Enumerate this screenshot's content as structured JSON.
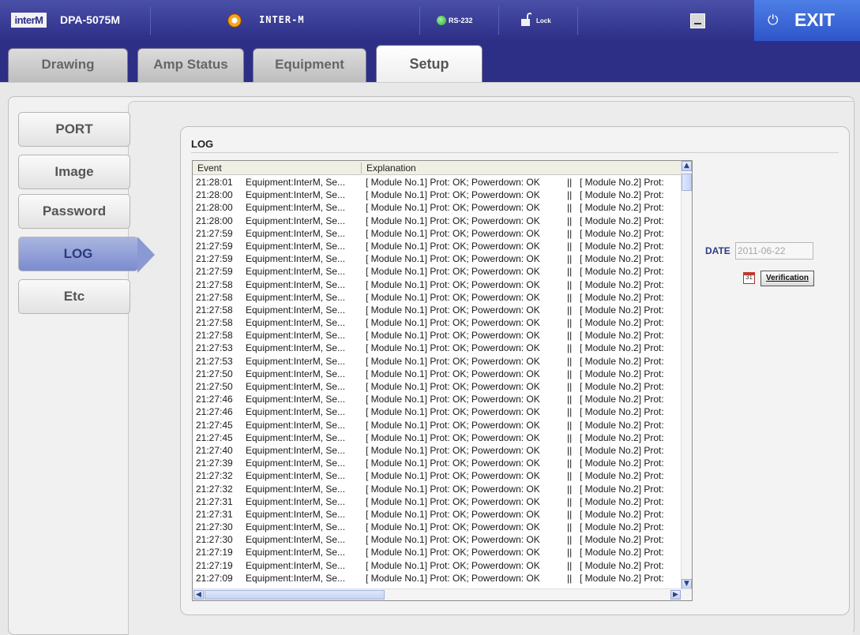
{
  "header": {
    "logo": "interM",
    "model": "DPA-5075M",
    "device_name": "INTER-M",
    "rs_label": "RS-232",
    "lock_label": "Lock",
    "exit_label": "EXIT"
  },
  "tabs": [
    {
      "label": "Drawing",
      "active": false
    },
    {
      "label": "Amp Status",
      "active": false
    },
    {
      "label": "Equipment",
      "active": false
    },
    {
      "label": "Setup",
      "active": true
    }
  ],
  "sidebar": {
    "items": [
      {
        "label": "PORT"
      },
      {
        "label": "Image"
      },
      {
        "label": "Password"
      },
      {
        "label": "LOG",
        "active": true
      },
      {
        "label": "Etc"
      }
    ]
  },
  "log": {
    "title": "LOG",
    "columns": [
      "Event",
      "Explanation"
    ],
    "rows": [
      {
        "time": "21:28:01",
        "equipment": "Equipment:InterM, Se...",
        "explanation": "[ Module No.1] Prot: OK; Powerdown: OK",
        "sep": "||",
        "module2": "[ Module No.2] Prot:"
      },
      {
        "time": "21:28:00",
        "equipment": "Equipment:InterM, Se...",
        "explanation": "[ Module No.1] Prot: OK; Powerdown: OK",
        "sep": "||",
        "module2": "[ Module No.2] Prot:"
      },
      {
        "time": "21:28:00",
        "equipment": "Equipment:InterM, Se...",
        "explanation": "[ Module No.1] Prot: OK; Powerdown: OK",
        "sep": "||",
        "module2": "[ Module No.2] Prot:"
      },
      {
        "time": "21:28:00",
        "equipment": "Equipment:InterM, Se...",
        "explanation": "[ Module No.1] Prot: OK; Powerdown: OK",
        "sep": "||",
        "module2": "[ Module No.2] Prot:"
      },
      {
        "time": "21:27:59",
        "equipment": "Equipment:InterM, Se...",
        "explanation": "[ Module No.1] Prot: OK; Powerdown: OK",
        "sep": "||",
        "module2": "[ Module No.2] Prot:"
      },
      {
        "time": "21:27:59",
        "equipment": "Equipment:InterM, Se...",
        "explanation": "[ Module No.1] Prot: OK; Powerdown: OK",
        "sep": "||",
        "module2": "[ Module No.2] Prot:"
      },
      {
        "time": "21:27:59",
        "equipment": "Equipment:InterM, Se...",
        "explanation": "[ Module No.1] Prot: OK; Powerdown: OK",
        "sep": "||",
        "module2": "[ Module No.2] Prot:"
      },
      {
        "time": "21:27:59",
        "equipment": "Equipment:InterM, Se...",
        "explanation": "[ Module No.1] Prot: OK; Powerdown: OK",
        "sep": "||",
        "module2": "[ Module No.2] Prot:"
      },
      {
        "time": "21:27:58",
        "equipment": "Equipment:InterM, Se...",
        "explanation": "[ Module No.1] Prot: OK; Powerdown: OK",
        "sep": "||",
        "module2": "[ Module No.2] Prot:"
      },
      {
        "time": "21:27:58",
        "equipment": "Equipment:InterM, Se...",
        "explanation": "[ Module No.1] Prot: OK; Powerdown: OK",
        "sep": "||",
        "module2": "[ Module No.2] Prot:"
      },
      {
        "time": "21:27:58",
        "equipment": "Equipment:InterM, Se...",
        "explanation": "[ Module No.1] Prot: OK; Powerdown: OK",
        "sep": "||",
        "module2": "[ Module No.2] Prot:"
      },
      {
        "time": "21:27:58",
        "equipment": "Equipment:InterM, Se...",
        "explanation": "[ Module No.1] Prot: OK; Powerdown: OK",
        "sep": "||",
        "module2": "[ Module No.2] Prot:"
      },
      {
        "time": "21:27:58",
        "equipment": "Equipment:InterM, Se...",
        "explanation": "[ Module No.1] Prot: OK; Powerdown: OK",
        "sep": "||",
        "module2": "[ Module No.2] Prot:"
      },
      {
        "time": "21:27:53",
        "equipment": "Equipment:InterM, Se...",
        "explanation": "[ Module No.1] Prot: OK; Powerdown: OK",
        "sep": "||",
        "module2": "[ Module No.2] Prot:"
      },
      {
        "time": "21:27:53",
        "equipment": "Equipment:InterM, Se...",
        "explanation": "[ Module No.1] Prot: OK; Powerdown: OK",
        "sep": "||",
        "module2": "[ Module No.2] Prot:"
      },
      {
        "time": "21:27:50",
        "equipment": "Equipment:InterM, Se...",
        "explanation": "[ Module No.1] Prot: OK; Powerdown: OK",
        "sep": "||",
        "module2": "[ Module No.2] Prot:"
      },
      {
        "time": "21:27:50",
        "equipment": "Equipment:InterM, Se...",
        "explanation": "[ Module No.1] Prot: OK; Powerdown: OK",
        "sep": "||",
        "module2": "[ Module No.2] Prot:"
      },
      {
        "time": "21:27:46",
        "equipment": "Equipment:InterM, Se...",
        "explanation": "[ Module No.1] Prot: OK; Powerdown: OK",
        "sep": "||",
        "module2": "[ Module No.2] Prot:"
      },
      {
        "time": "21:27:46",
        "equipment": "Equipment:InterM, Se...",
        "explanation": "[ Module No.1] Prot: OK; Powerdown: OK",
        "sep": "||",
        "module2": "[ Module No.2] Prot:"
      },
      {
        "time": "21:27:45",
        "equipment": "Equipment:InterM, Se...",
        "explanation": "[ Module No.1] Prot: OK; Powerdown: OK",
        "sep": "||",
        "module2": "[ Module No.2] Prot:"
      },
      {
        "time": "21:27:45",
        "equipment": "Equipment:InterM, Se...",
        "explanation": "[ Module No.1] Prot: OK; Powerdown: OK",
        "sep": "||",
        "module2": "[ Module No.2] Prot:"
      },
      {
        "time": "21:27:40",
        "equipment": "Equipment:InterM, Se...",
        "explanation": "[ Module No.1] Prot: OK; Powerdown: OK",
        "sep": "||",
        "module2": "[ Module No.2] Prot:"
      },
      {
        "time": "21:27:39",
        "equipment": "Equipment:InterM, Se...",
        "explanation": "[ Module No.1] Prot: OK; Powerdown: OK",
        "sep": "||",
        "module2": "[ Module No.2] Prot:"
      },
      {
        "time": "21:27:32",
        "equipment": "Equipment:InterM, Se...",
        "explanation": "[ Module No.1] Prot: OK; Powerdown: OK",
        "sep": "||",
        "module2": "[ Module No.2] Prot:"
      },
      {
        "time": "21:27:32",
        "equipment": "Equipment:InterM, Se...",
        "explanation": "[ Module No.1] Prot: OK; Powerdown: OK",
        "sep": "||",
        "module2": "[ Module No.2] Prot:"
      },
      {
        "time": "21:27:31",
        "equipment": "Equipment:InterM, Se...",
        "explanation": "[ Module No.1] Prot: OK; Powerdown: OK",
        "sep": "||",
        "module2": "[ Module No.2] Prot:"
      },
      {
        "time": "21:27:31",
        "equipment": "Equipment:InterM, Se...",
        "explanation": "[ Module No.1] Prot: OK; Powerdown: OK",
        "sep": "||",
        "module2": "[ Module No.2] Prot:"
      },
      {
        "time": "21:27:30",
        "equipment": "Equipment:InterM, Se...",
        "explanation": "[ Module No.1] Prot: OK; Powerdown: OK",
        "sep": "||",
        "module2": "[ Module No.2] Prot:"
      },
      {
        "time": "21:27:30",
        "equipment": "Equipment:InterM, Se...",
        "explanation": "[ Module No.1] Prot: OK; Powerdown: OK",
        "sep": "||",
        "module2": "[ Module No.2] Prot:"
      },
      {
        "time": "21:27:19",
        "equipment": "Equipment:InterM, Se...",
        "explanation": "[ Module No.1] Prot: OK; Powerdown: OK",
        "sep": "||",
        "module2": "[ Module No.2] Prot:"
      },
      {
        "time": "21:27:19",
        "equipment": "Equipment:InterM, Se...",
        "explanation": "[ Module No.1] Prot: OK; Powerdown: OK",
        "sep": "||",
        "module2": "[ Module No.2] Prot:"
      },
      {
        "time": "21:27:09",
        "equipment": "Equipment:InterM, Se...",
        "explanation": "[ Module No.1] Prot: OK; Powerdown: OK",
        "sep": "||",
        "module2": "[ Module No.2] Prot:"
      }
    ]
  },
  "date_filter": {
    "label": "DATE",
    "value": "2011-06-22",
    "calendar_day": "31",
    "verify_label": "Verification"
  },
  "icons": {
    "status": "orange-ring-icon",
    "rs232": "green-led-icon",
    "lock": "unlock-icon",
    "minimize": "minimize-icon",
    "power": "power-icon",
    "calendar": "calendar-icon"
  },
  "colors": {
    "header_bg": "#2d2f86",
    "exit_bg": "#3a63d6",
    "active_side": "#8a99d4",
    "date_label": "#2d3a86"
  }
}
